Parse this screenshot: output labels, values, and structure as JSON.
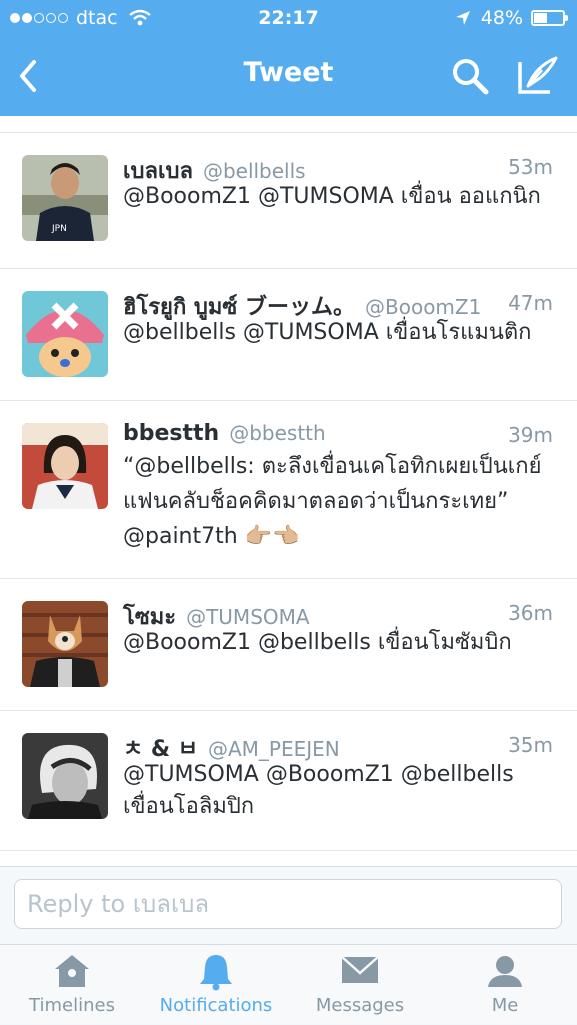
{
  "status_bar": {
    "carrier": "dtac",
    "time": "22:17",
    "battery": "48%",
    "signal_bars_full": 2,
    "signal_bars_total": 5
  },
  "nav": {
    "title": "Tweet",
    "icons": {
      "back": "chevron-left-icon",
      "search": "search-icon",
      "compose": "compose-icon"
    }
  },
  "tweets": [
    {
      "name": "เบลเบล",
      "handle": "@bellbells",
      "time": "53m",
      "text": "@BooomZ1 @TUMSOMA เขื่อน ออแกนิก"
    },
    {
      "name": "ฮิโรยูกิ บูมซ์ ブーッム。",
      "handle": "@BooomZ1",
      "time": "47m",
      "text": "@bellbells @TUMSOMA เขื่อนโรแมนติก"
    },
    {
      "name": "bbestth",
      "handle": "@bbestth",
      "time": "39m",
      "text": "“@bellbells: ตะลึงเขื่อนเคโอทิกเผยเป็นเกย์ แฟนคลับช็อคคิดมาตลอดว่าเป็นกระเทย” @paint7th 👉🏼👈🏼"
    },
    {
      "name": "โซมะ",
      "handle": "@TUMSOMA",
      "time": "36m",
      "text": "@BooomZ1 @bellbells เขื่อนโมซัมบิก"
    },
    {
      "name": "ㅊ & ㅂ",
      "handle": "@AM_PEEJEN",
      "time": "35m",
      "text": "@TUMSOMA @BooomZ1 @bellbells เขื่อนโอลิมปิก"
    }
  ],
  "reply": {
    "placeholder": "Reply to เบลเบล",
    "value": ""
  },
  "tabs": [
    {
      "label": "Timelines",
      "icon": "home-icon",
      "active": false
    },
    {
      "label": "Notifications",
      "icon": "bell-icon",
      "active": true
    },
    {
      "label": "Messages",
      "icon": "envelope-icon",
      "active": false
    },
    {
      "label": "Me",
      "icon": "person-icon",
      "active": false
    }
  ],
  "colors": {
    "brand": "#55acee",
    "text": "#292f33",
    "secondary": "#8899a6"
  }
}
